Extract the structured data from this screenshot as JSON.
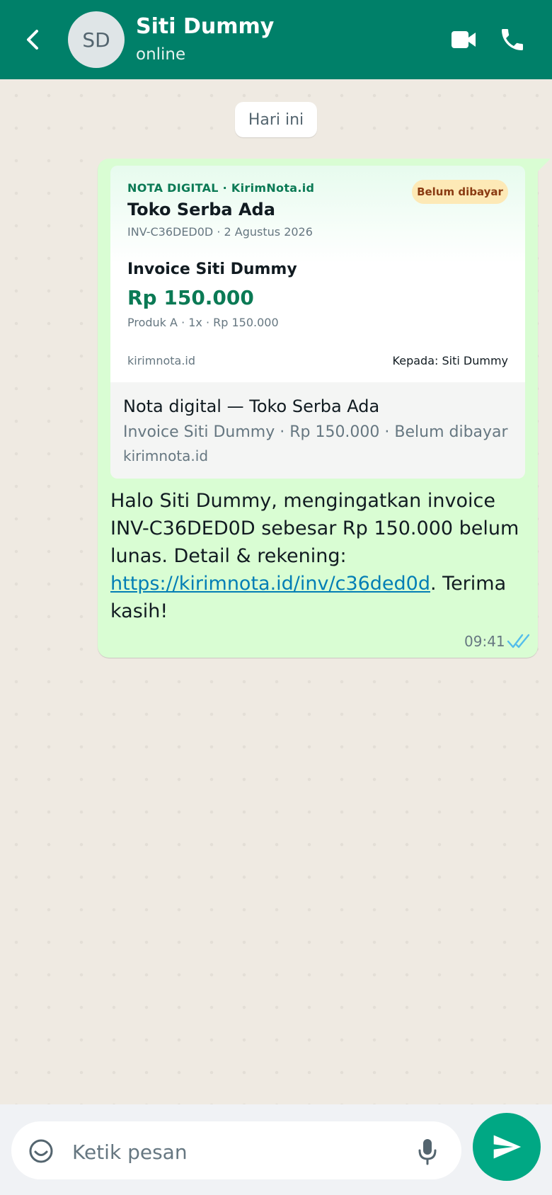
{
  "header": {
    "avatar_initials": "SD",
    "name": "Siti Dummy",
    "status": "online"
  },
  "chat": {
    "date_chip": "Hari ini",
    "message": {
      "card": {
        "brand": "NOTA DIGITAL · KirimNota.id",
        "store": "Toko Serba Ada",
        "meta": "INV-C36DED0D · 2 Agustus 2026",
        "status_badge": "Belum dibayar",
        "invoice_title": "Invoice Siti Dummy",
        "amount": "Rp 150.000",
        "items": "Produk A · 1x · Rp 150.000",
        "domain": "kirimnota.id",
        "recipient": "Kepada: Siti Dummy"
      },
      "preview": {
        "title": "Nota digital — Toko Serba Ada",
        "description": "Invoice Siti Dummy · Rp 150.000 · Belum dibayar",
        "domain": "kirimnota.id"
      },
      "text_before_link": "Halo Siti Dummy, mengingatkan invoice INV-C36DED0D sebesar Rp 150.000 belum lunas. Detail & rekening: ",
      "link": "https://kirimnota.id/inv/c36ded0d",
      "text_after_link": ". Terima kasih!",
      "time": "09:41",
      "status": "read"
    }
  },
  "composer": {
    "placeholder": "Ketik pesan"
  },
  "colors": {
    "header": "#008069",
    "outgoing_bubble": "#d9fdd3",
    "chat_background": "#efeae2",
    "accent": "#00a884",
    "read_ticks": "#53bdeb",
    "amount": "#0b7a55"
  },
  "icons": {
    "back": "chevron-left-icon",
    "video": "video-camera-icon",
    "call": "phone-icon",
    "ticks": "double-check-icon",
    "emoji": "emoji-icon",
    "mic": "microphone-icon",
    "send": "send-icon"
  }
}
